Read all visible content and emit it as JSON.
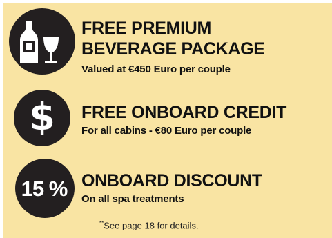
{
  "offers": [
    {
      "icon": "wine-bottle-glass-icon",
      "title_line1": "FREE PREMIUM",
      "title_line2": "BEVERAGE PACKAGE",
      "subtitle": "Valued at €450 Euro per couple"
    },
    {
      "icon": "dollar-icon",
      "icon_text": "$",
      "title": "FREE ONBOARD CREDIT",
      "subtitle": "For all cabins - €80 Euro per couple"
    },
    {
      "icon": "percent-badge-icon",
      "icon_text": "15 %",
      "title": "ONBOARD DISCOUNT",
      "subtitle": "On all spa treatments"
    }
  ],
  "footnote_mark": "**",
  "footnote": "See page 18 for details.",
  "colors": {
    "background": "#f9e4a3",
    "circle": "#231f20",
    "text": "#111111"
  }
}
